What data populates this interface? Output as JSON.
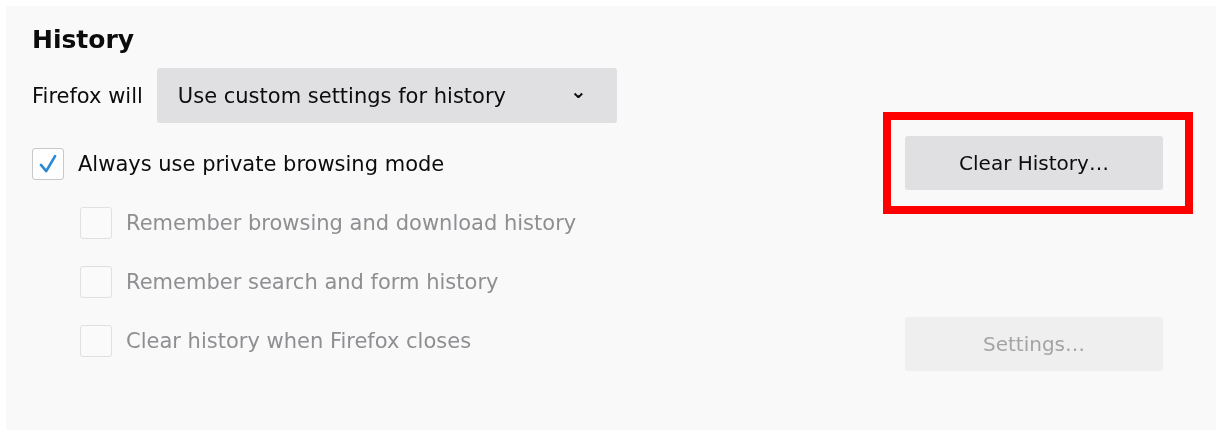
{
  "section": {
    "title": "History"
  },
  "history_mode": {
    "label": "Firefox will",
    "value": "Use custom settings for history",
    "caret": "⌄"
  },
  "options": [
    {
      "label": "Always use private browsing mode",
      "checked": true,
      "disabled": false,
      "children": [
        {
          "label": "Remember browsing and download history",
          "checked": false,
          "disabled": true
        },
        {
          "label": "Remember search and form history",
          "checked": false,
          "disabled": true
        },
        {
          "label": "Clear history when Firefox closes",
          "checked": false,
          "disabled": true
        }
      ]
    }
  ],
  "buttons": [
    {
      "label": "Clear History…",
      "disabled": false,
      "highlighted": true
    },
    {
      "label": "Settings…",
      "disabled": true,
      "highlighted": false
    }
  ]
}
